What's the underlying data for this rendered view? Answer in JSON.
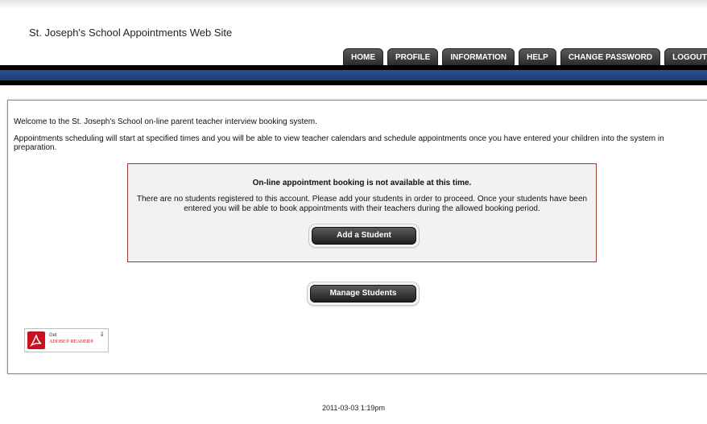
{
  "header": {
    "site_title": "St. Joseph's School Appointments Web Site"
  },
  "nav": {
    "tabs": [
      {
        "label": "HOME"
      },
      {
        "label": "PROFILE"
      },
      {
        "label": "INFORMATION"
      },
      {
        "label": "HELP"
      },
      {
        "label": "CHANGE PASSWORD"
      },
      {
        "label": "LOGOUT"
      }
    ]
  },
  "main": {
    "welcome": "Welcome to the St. Joseph's School on-line parent teacher interview booking system.",
    "info": "Appointments scheduling will start at specified times and you will be able to view teacher calendars and schedule appointments once you have entered your children into the system in preparation.",
    "alert": {
      "title": "On-line appointment booking is not available at this time.",
      "text": "There are no students registered to this account. Please add your students in order to proceed. Once your students have been entered you will be able to book appointments with their teachers during the allowed booking period.",
      "add_button": "Add a Student"
    },
    "manage_button": "Manage Students",
    "adobe_badge": {
      "get": "Get",
      "name": "ADOBE® READER®",
      "icon": "adobe-pdf-icon"
    }
  },
  "footer": {
    "timestamp": "2011-03-03 1:19pm"
  },
  "colors": {
    "nav_blue_bar": "#1b3d75",
    "alert_border": "#9b3a2c",
    "adobe_red": "#c8101e"
  }
}
